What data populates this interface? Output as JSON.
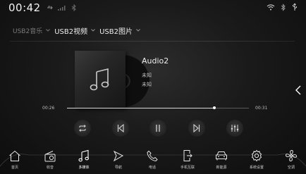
{
  "status": {
    "time": "00:42",
    "icons_left": [
      "usb-icon",
      "signal-icon",
      "bluetooth-icon"
    ],
    "icons_right": [
      "wifi-icon",
      "bluetooth-icon",
      "usb-icon"
    ]
  },
  "tabs": [
    {
      "label": "USB2音乐",
      "active": false
    },
    {
      "label": "USB2视频",
      "active": true
    },
    {
      "label": "USB2图片",
      "active": false
    }
  ],
  "song": {
    "title": "Audio2",
    "artist": "未知",
    "album": "未知",
    "cover_icon": "music-note-icon"
  },
  "progress": {
    "current": "00:26",
    "total": "00:31",
    "fraction": 0.81
  },
  "controls": [
    "repeat-icon",
    "previous-icon",
    "pause-icon",
    "next-icon",
    "equalizer-icon"
  ],
  "dock": [
    {
      "label": "首页",
      "icon": "home-icon"
    },
    {
      "label": "收音",
      "icon": "radio-icon"
    },
    {
      "label": "多媒体",
      "icon": "music-icon",
      "active": true
    },
    {
      "label": "导航",
      "icon": "navigation-icon"
    },
    {
      "label": "电话",
      "icon": "phone-icon"
    },
    {
      "label": "手机互联",
      "icon": "phone-link-icon"
    },
    {
      "label": "新能源",
      "icon": "car-icon"
    },
    {
      "label": "系统设置",
      "icon": "gear-icon"
    },
    {
      "label": "空调",
      "icon": "fan-icon"
    }
  ],
  "colors": {
    "background": "#1a1a1a",
    "text": "#e6e6e6",
    "inactive_text": "#7a7a7a",
    "track": "#5a5a5a"
  }
}
